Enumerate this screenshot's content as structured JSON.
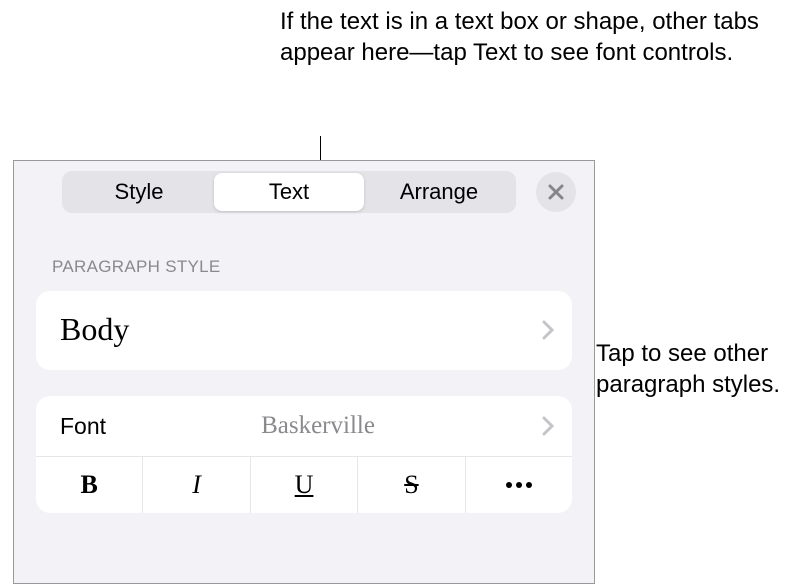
{
  "callouts": {
    "top": "If the text is in a text box or shape, other tabs appear here—tap Text to see font controls.",
    "right": "Tap to see other paragraph styles."
  },
  "tabs": {
    "style": "Style",
    "text": "Text",
    "arrange": "Arrange"
  },
  "section": {
    "paragraph_style_header": "PARAGRAPH STYLE",
    "paragraph_style_value": "Body"
  },
  "font": {
    "label": "Font",
    "value": "Baskerville"
  },
  "style_buttons": {
    "bold": "B",
    "italic": "I",
    "underline": "U",
    "strike": "S"
  }
}
